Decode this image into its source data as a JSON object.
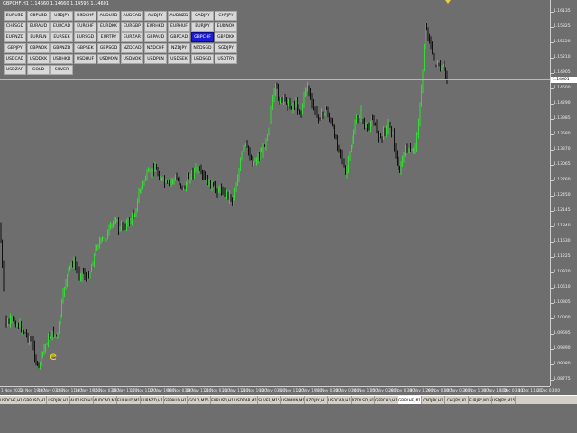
{
  "chart": {
    "header": "GBPCHF,H1  1.14660 1.14660 1.14596 1.14601",
    "current_price": "1.14601",
    "annotation": "e",
    "bar_colors": {
      "bull": "#32dc32",
      "bear": "#101010",
      "line": "#e0c030",
      "bg": "#6e6e6e"
    }
  },
  "symbol_buttons": [
    "EURUSD",
    "GBPUSD",
    "USDJPY",
    "USDCHF",
    "AUDUSD",
    "AUDCAD",
    "AUDJPY",
    "AUDNZD",
    "CADJPY",
    "CHFJPY",
    "CHFSGD",
    "EURAUD",
    "EURCAD",
    "EURCHF",
    "EURDKK",
    "EURGBP",
    "EURHKD",
    "EURHUF",
    "EURJPY",
    "EURNOK",
    "EURNZD",
    "EURPLN",
    "EURSEK",
    "EURSGD",
    "EURTRY",
    "EURZAR",
    "GBPAUD",
    "GBPCAD",
    "GBPCHF",
    "GBPDKK",
    "GBPJPY",
    "GBPNOK",
    "GBPNZD",
    "GBPSEK",
    "GBPSGD",
    "NZDCAD",
    "NZDCHF",
    "NZDJPY",
    "NZDSGD",
    "SGDJPY",
    "USDCAD",
    "USDDKK",
    "USDHKD",
    "USDHUF",
    "USDMXN",
    "USDNOK",
    "USDPLN",
    "USDSEK",
    "USDSGD",
    "USDTRY",
    "USDZAR",
    "GOLD",
    "SILVER"
  ],
  "active_symbol": "GBPCHF",
  "price_axis": [
    "1.16135",
    "1.15825",
    "1.15520",
    "1.15210",
    "1.14905",
    "1.14600",
    "1.14290",
    "1.13985",
    "1.13680",
    "1.13370",
    "1.13065",
    "1.12760",
    "1.12450",
    "1.12145",
    "1.11840",
    "1.11530",
    "1.11225",
    "1.10920",
    "1.10610",
    "1.10305",
    "1.10000",
    "1.09695",
    "1.09390",
    "1.09080",
    "1.08775"
  ],
  "time_axis": [
    "1 Nov 2022",
    "14 Nov 19:00",
    "15 Nov 03:00",
    "15 Nov 11:00",
    "15 Nov 19:00",
    "16 Nov 03:00",
    "16 Nov 11:00",
    "17 Nov 11:00",
    "17 Nov 19:00",
    "18 Nov 03:00",
    "18 Nov 11:00",
    "21 Nov 03:00",
    "21 Nov 11:00",
    "21 Nov 19:00",
    "22 Nov 03:00",
    "22 Nov 11:00",
    "22 Nov 19:00",
    "23 Nov 03:00",
    "24 Nov 03:00",
    "24 Nov 11:00",
    "25 Nov 03:00",
    "28 Nov 03:00",
    "28 Nov 11:00",
    "29 Nov 03:00",
    "30 Nov 03:00",
    "30 Nov 11:00",
    "30 Nov 19:00",
    "1 Dec 03:00",
    "1 Dec 11:00",
    "2 Dec 03:00"
  ],
  "tabs": [
    "USDCHF,H1",
    "GBPUSD,H1",
    "USDJPY,H1",
    "AUDUSD,H1",
    "AUDCAD,M15",
    "EURAUD,M15",
    "EURNZD,H1",
    "GBPAUD,H1",
    "GOLD,M15",
    "EURUSD,H1",
    "USDZAR,M15",
    "SILVER,M15",
    "USDMXN,M15",
    "NZDJPY,H1",
    "USDCAD,H1",
    "NZDUSD,H1",
    "GBPCAD,H1",
    "GBPCHF,M15",
    "CADJPY,H1",
    "CHFJPY,H1",
    "EURJPY,M15",
    "USDJPY,M15"
  ],
  "active_tab": "GBPCHF,M15"
}
